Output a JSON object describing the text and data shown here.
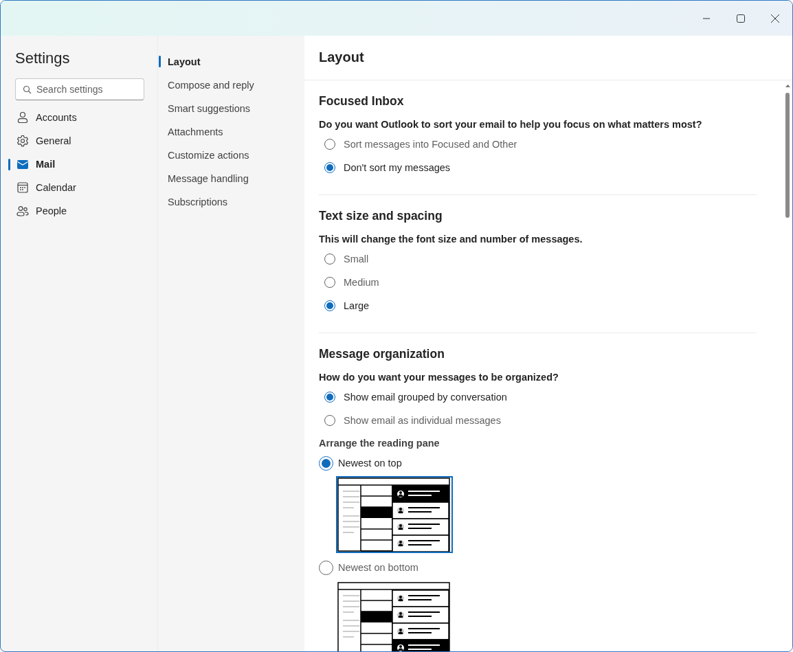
{
  "sidebar": {
    "title": "Settings",
    "search": {
      "placeholder": "Search settings"
    },
    "items": [
      {
        "label": "Accounts",
        "selected": false
      },
      {
        "label": "General",
        "selected": false
      },
      {
        "label": "Mail",
        "selected": true
      },
      {
        "label": "Calendar",
        "selected": false
      },
      {
        "label": "People",
        "selected": false
      }
    ]
  },
  "subnav": {
    "items": [
      {
        "label": "Layout",
        "selected": true
      },
      {
        "label": "Compose and reply",
        "selected": false
      },
      {
        "label": "Smart suggestions",
        "selected": false
      },
      {
        "label": "Attachments",
        "selected": false
      },
      {
        "label": "Customize actions",
        "selected": false
      },
      {
        "label": "Message handling",
        "selected": false
      },
      {
        "label": "Subscriptions",
        "selected": false
      }
    ]
  },
  "content": {
    "title": "Layout",
    "sections": [
      {
        "title": "Focused Inbox",
        "question": "Do you want Outlook to sort your email to help you focus on what matters most?",
        "options": [
          {
            "label": "Sort messages into Focused and Other",
            "selected": false
          },
          {
            "label": "Don't sort my messages",
            "selected": true
          }
        ]
      },
      {
        "title": "Text size and spacing",
        "question": "This will change the font size and number of messages.",
        "options": [
          {
            "label": "Small",
            "selected": false
          },
          {
            "label": "Medium",
            "selected": false
          },
          {
            "label": "Large",
            "selected": true
          }
        ]
      },
      {
        "title": "Message organization",
        "question": "How do you want your messages to be organized?",
        "options": [
          {
            "label": "Show email grouped by conversation",
            "selected": true
          },
          {
            "label": "Show email as individual messages",
            "selected": false
          }
        ],
        "subsection": {
          "title": "Arrange the reading pane",
          "options": [
            {
              "label": "Newest on top",
              "selected": true
            },
            {
              "label": "Newest on bottom",
              "selected": false
            }
          ]
        }
      }
    ]
  }
}
